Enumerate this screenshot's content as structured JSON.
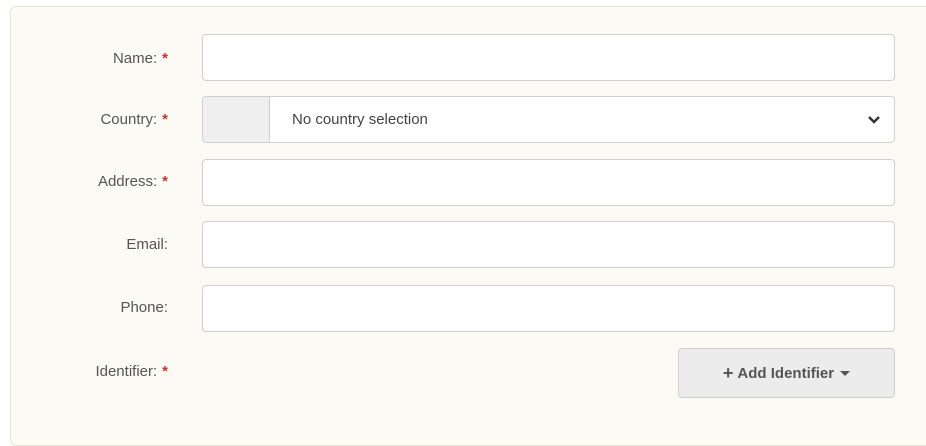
{
  "form": {
    "name": {
      "label": "Name:",
      "required_mark": "*",
      "value": ""
    },
    "country": {
      "label": "Country:",
      "required_mark": "*",
      "selected": "No country selection",
      "icon": "chevron-down-icon"
    },
    "address": {
      "label": "Address:",
      "required_mark": "*",
      "value": ""
    },
    "email": {
      "label": "Email:",
      "value": ""
    },
    "phone": {
      "label": "Phone:",
      "value": ""
    },
    "identifier": {
      "label": "Identifier:",
      "required_mark": "*",
      "button_plus": "+",
      "button_label": "Add Identifier"
    }
  },
  "colors": {
    "panel_bg": "#fbfaf4",
    "required": "#c9302c",
    "button_bg": "#ececec"
  }
}
